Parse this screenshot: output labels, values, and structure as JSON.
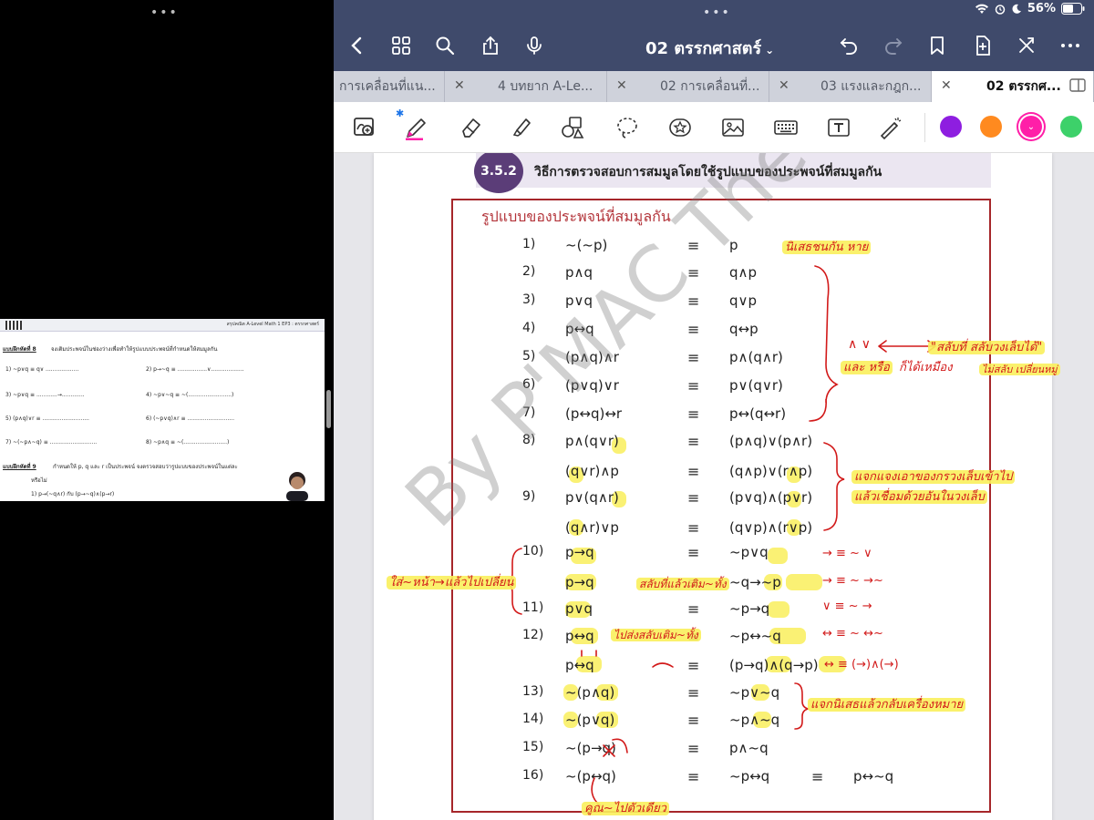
{
  "left_pane": {
    "header_title": "สรุปคณิต A-Level Math 1 EP3 : ตรรกศาสตร์",
    "lines": [
      {
        "text": "แบบฝึกหัดที่ 8",
        "bold": true
      },
      {
        "text": "จงเติมประพจน์ในช่องว่างเพื่อทำให้รูปแบบประพจน์ที่กำหนดให้สมมูลกัน"
      },
      {
        "text": "1) ~p∨q    ≡ q∨ ..................."
      },
      {
        "text": "2) p→~q    ≡ .................∨..................."
      },
      {
        "text": "3) ~p∨q    ≡ ............→............."
      },
      {
        "text": "4) ~p∨~q    ≡ ~(.........................)"
      },
      {
        "text": "5) (p∧q)∨r ≡ ..........................."
      },
      {
        "text": "6) (~p∨q)∧r    ≡ ..........................."
      },
      {
        "text": "7) ~(~p∧~q) ≡ ..........................."
      },
      {
        "text": "8) ~p∧q    ≡ ~(.........................)"
      },
      {
        "text": "แบบฝึกหัดที่ 9",
        "bold": true
      },
      {
        "text": "กำหนดให้ p, q และ r เป็นประพจน์ จงตรวจสอบว่ารูปแบบของประพจน์ในแต่ละ"
      },
      {
        "text": "หรือไม่"
      },
      {
        "text": "1) p→(~q∧r) กับ (p→~q)∧(p→r)"
      }
    ]
  },
  "status": {
    "battery": "56%"
  },
  "nav": {
    "title": "02 ตรรกศาสตร์"
  },
  "tabs": [
    {
      "label": "การเคลื่อนที่แน...",
      "active": false
    },
    {
      "label": "4 บทยาก A-Le...",
      "active": false
    },
    {
      "label": "02 การเคลื่อนที่...",
      "active": false
    },
    {
      "label": "03 แรงและกฎก...",
      "active": false
    },
    {
      "label": "02 ตรรกศ...",
      "active": true
    }
  ],
  "colors": {
    "nav_bg": "#3f4a6b",
    "tab_bg": "#c9ccd6",
    "frame": "#a6262a",
    "section_circle": "#5b3d78",
    "annotation_red": "#d21a1a",
    "highlight": "#f9ef5c",
    "swatch_purple": "#8e1ee0",
    "swatch_orange": "#ff8a1f",
    "swatch_pink": "#ff1fa8",
    "swatch_green": "#3dd16a"
  },
  "section": {
    "number": "3.5.2",
    "title": "วิธีการตรวจสอบการสมมูลโดยใช้รูปแบบของประพจน์ที่สมมูลกัน"
  },
  "frame_title": "รูปแบบของประพจน์ที่สมมูลกัน",
  "equiv_symbol": "≡",
  "rows": [
    {
      "num": "1)",
      "lhs": "~(~p)",
      "rhs": "p"
    },
    {
      "num": "2)",
      "lhs": "p∧q",
      "rhs": "q∧p"
    },
    {
      "num": "3)",
      "lhs": "p∨q",
      "rhs": "q∨p"
    },
    {
      "num": "4)",
      "lhs": "p↔q",
      "rhs": "q↔p"
    },
    {
      "num": "5)",
      "lhs": "(p∧q)∧r",
      "rhs": "p∧(q∧r)"
    },
    {
      "num": "6)",
      "lhs": "(p∨q)∨r",
      "rhs": "p∨(q∨r)"
    },
    {
      "num": "7)",
      "lhs": "(p↔q)↔r",
      "rhs": "p↔(q↔r)"
    },
    {
      "num": "8)",
      "lhs": "p∧(q∨r)",
      "rhs": "(p∧q)∨(p∧r)"
    },
    {
      "num": "",
      "lhs": "(q∨r)∧p",
      "rhs": "(q∧p)∨(r∧p)"
    },
    {
      "num": "9)",
      "lhs": "p∨(q∧r)",
      "rhs": "(p∨q)∧(p∨r)"
    },
    {
      "num": "",
      "lhs": "(q∧r)∨p",
      "rhs": "(q∨p)∧(r∨p)"
    },
    {
      "num": "10)",
      "lhs": "p→q",
      "rhs": "~p∨q"
    },
    {
      "num": "",
      "lhs": "p→q",
      "rhs": "~q→~p"
    },
    {
      "num": "11)",
      "lhs": "p∨q",
      "rhs": "~p→q"
    },
    {
      "num": "12)",
      "lhs": "p↔q",
      "rhs": "~p↔~q"
    },
    {
      "num": "",
      "lhs": "p↔q",
      "rhs": "(p→q)∧(q→p)"
    },
    {
      "num": "13)",
      "lhs": "~(p∧q)",
      "rhs": "~p∨~q"
    },
    {
      "num": "14)",
      "lhs": "~(p∨q)",
      "rhs": "~p∧~q"
    },
    {
      "num": "15)",
      "lhs": "~(p→q)",
      "rhs": "p∧~q"
    },
    {
      "num": "16)",
      "lhs": "~(p↔q)",
      "rhs": "~p↔q",
      "extra_equiv": "≡",
      "extra": "p↔~q"
    }
  ],
  "notes": {
    "n1": "นิเสธชนกัน หาย",
    "n2a": "∧  ∨",
    "n2b": "และ หรือ",
    "n2c": "ก็ได้เหมือง",
    "n2d": "\"สลับที่ สลับวงเล็บได้\"",
    "n2e": "ไม่สลับ เปลี่ยนหมู่",
    "n3a": "แจกแจงเอาของกรวงเล็บเข้าไป",
    "n3b": "แล้วเชื่อมด้วยอันในวงเล็บ",
    "n4": "ใส่~หน้า→แล้วไปเปลี่ยน",
    "n5": "สลับที่แล้วเติม~ทั้ง",
    "n6": "ไปส่งสลับเติม~ทั้ง",
    "n7": "แจกนิเสธแล้วกลับเครื่องหมาย",
    "n8": "คูณ~ไปตัวเดียว",
    "side1": "→  ≡  ~  ∨",
    "side2": "→  ≡  ~    →~",
    "side3": "∨  ≡  ~  →",
    "side4": "↔  ≡  ~  ↔~",
    "side5": "↔  ≡ (→)∧(→)"
  },
  "watermark": "By P'MAC The NEW GEN"
}
